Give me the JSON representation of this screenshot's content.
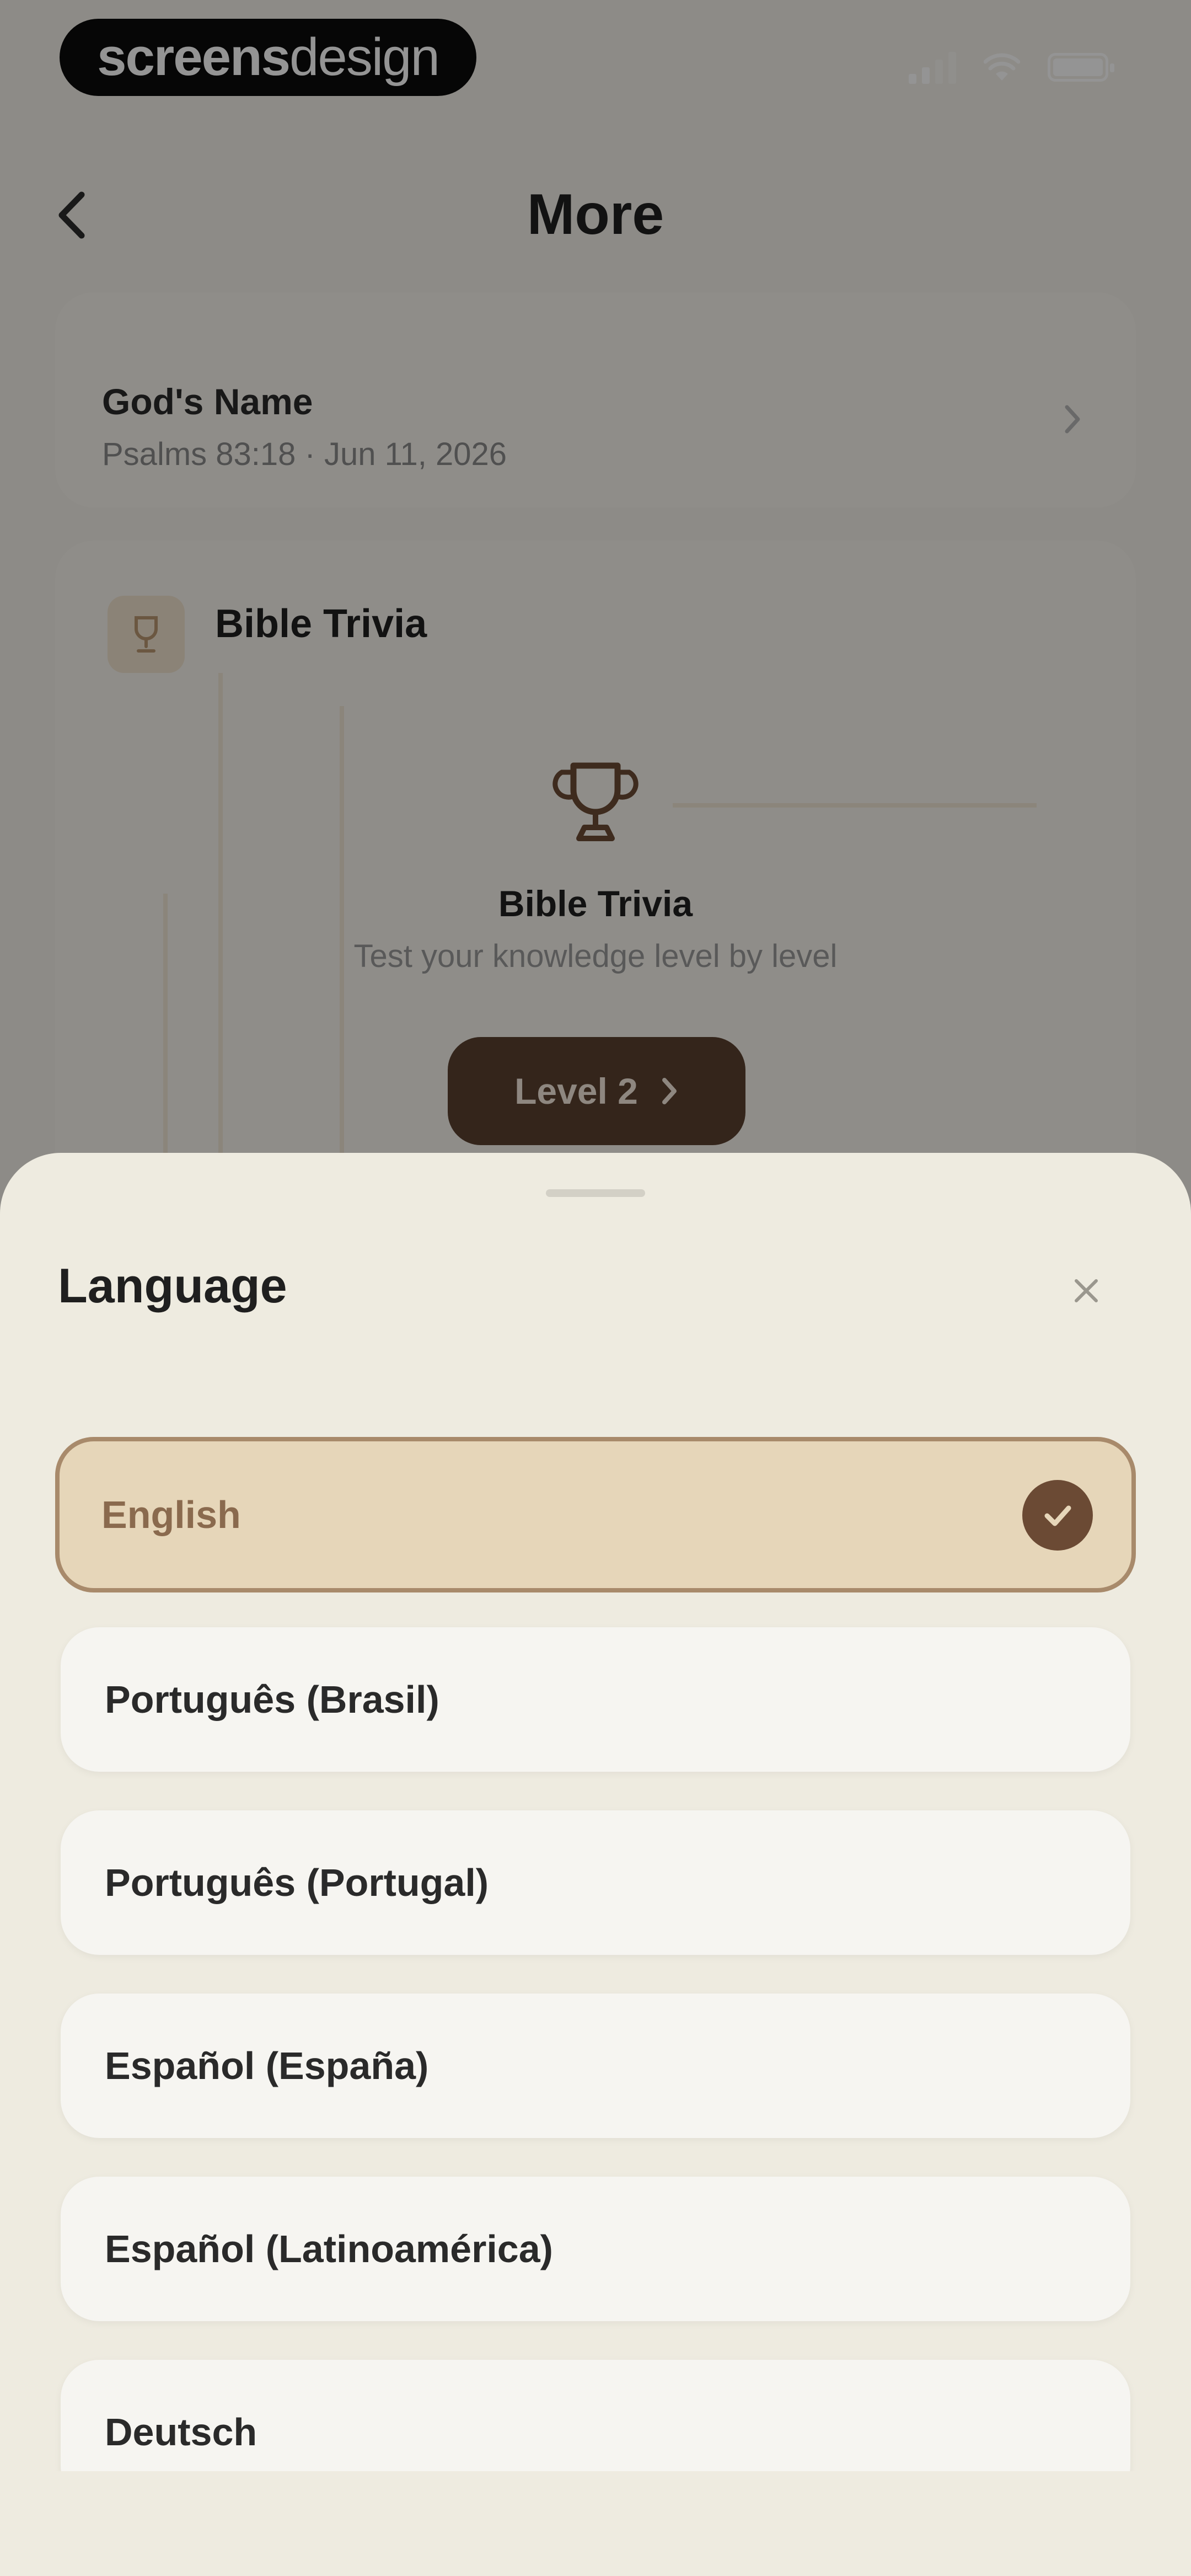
{
  "status_bar": {
    "logo_part1": "screens",
    "logo_part2": "design"
  },
  "nav": {
    "title": "More"
  },
  "gods_name_card": {
    "title": "God's Name",
    "subtitle": "Psalms 83:18 · Jun 11, 2026"
  },
  "bible_trivia_card": {
    "header": "Bible Trivia",
    "title": "Bible Trivia",
    "subtitle": "Test your knowledge level by level",
    "level_button": "Level 2"
  },
  "language_sheet": {
    "title": "Language",
    "items": [
      {
        "label": "English",
        "selected": true
      },
      {
        "label": "Português (Brasil)",
        "selected": false
      },
      {
        "label": "Português (Portugal)",
        "selected": false
      },
      {
        "label": "Español (España)",
        "selected": false
      },
      {
        "label": "Español (Latinoamérica)",
        "selected": false
      },
      {
        "label": "Deutsch",
        "selected": false
      }
    ]
  },
  "colors": {
    "accent_brown": "#5a4030",
    "selected_bg": "#e6d6b9",
    "selected_border": "#a88a6b",
    "sheet_bg": "#eeebe0"
  },
  "icons": [
    "back-chevron-icon",
    "trophy-icon",
    "chevron-right-icon",
    "close-icon",
    "checkmark-icon",
    "signal-icon",
    "wifi-icon",
    "battery-icon"
  ]
}
